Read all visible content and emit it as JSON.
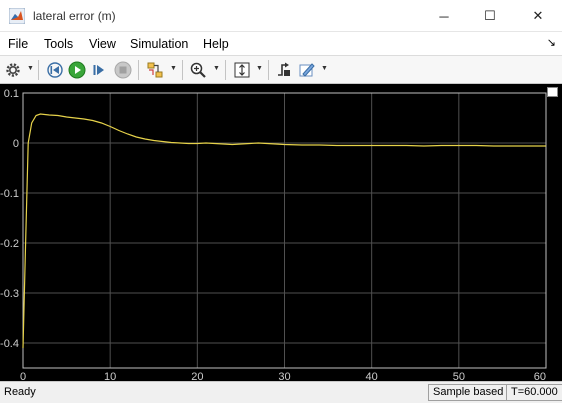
{
  "window": {
    "title": "lateral error (m)",
    "minimize_glyph": "─",
    "maximize_glyph": "☐",
    "close_glyph": "✕"
  },
  "menu": {
    "items": [
      {
        "label": "File"
      },
      {
        "label": "Tools"
      },
      {
        "label": "View"
      },
      {
        "label": "Simulation"
      },
      {
        "label": "Help"
      }
    ],
    "collapse_glyph": "↘"
  },
  "toolbar": {
    "icons": [
      "gear-icon",
      "step-back-icon",
      "run-icon",
      "step-forward-icon",
      "stop-icon",
      "signal-select-icon",
      "zoom-icon",
      "autoscale-icon",
      "triggers-icon",
      "highlight-icon"
    ]
  },
  "status": {
    "ready": "Ready",
    "mode": "Sample based",
    "time": "T=60.000"
  },
  "colors": {
    "plot_bg": "#000000",
    "grid": "#505050",
    "axis_frame": "#c0c0c0",
    "tick_label": "#cccccc",
    "trace": "#e6d24a"
  },
  "chart_data": {
    "type": "line",
    "xlim": [
      0,
      60
    ],
    "ylim": [
      -0.45,
      0.1
    ],
    "xticks": [
      0,
      10,
      20,
      30,
      40,
      50,
      60
    ],
    "yticks": [
      0.1,
      0,
      -0.1,
      -0.2,
      -0.3,
      -0.4
    ],
    "ytick_labels": [
      "0.1",
      "0",
      "-0.1",
      "-0.2",
      "-0.3",
      "-0.4"
    ],
    "xtick_labels": [
      "0",
      "10",
      "20",
      "30",
      "40",
      "50",
      "60"
    ],
    "grid": true,
    "series": [
      {
        "x": [
          0,
          0.3,
          0.6,
          1.0,
          1.5,
          2.0,
          3.0,
          4.0,
          5.0,
          6.0,
          7.0,
          8.0,
          9.0,
          10.0,
          11.0,
          12.0,
          13.0,
          14.0,
          15.0,
          16.0,
          17.0,
          18.0,
          19.0,
          20.0,
          21.0,
          22.0,
          23.0,
          24.0,
          25.0,
          26.0,
          27.0,
          28.0,
          29.0,
          30.0,
          32.0,
          34.0,
          36.0,
          38.0,
          40.0,
          42.0,
          44.0,
          46.0,
          48.0,
          50.0,
          52.0,
          54.0,
          56.0,
          58.0,
          60.0
        ],
        "y": [
          -0.41,
          -0.2,
          0.0,
          0.04,
          0.055,
          0.058,
          0.056,
          0.055,
          0.052,
          0.05,
          0.048,
          0.045,
          0.04,
          0.033,
          0.025,
          0.018,
          0.012,
          0.008,
          0.005,
          0.003,
          0.001,
          0.0,
          -0.001,
          -0.001,
          0.0,
          -0.001,
          -0.002,
          -0.003,
          -0.002,
          -0.001,
          0.0,
          -0.001,
          -0.002,
          -0.003,
          -0.004,
          -0.004,
          -0.005,
          -0.005,
          -0.005,
          -0.005,
          -0.005,
          -0.006,
          -0.005,
          -0.005,
          -0.005,
          -0.006,
          -0.006,
          -0.006,
          -0.006
        ]
      }
    ]
  }
}
